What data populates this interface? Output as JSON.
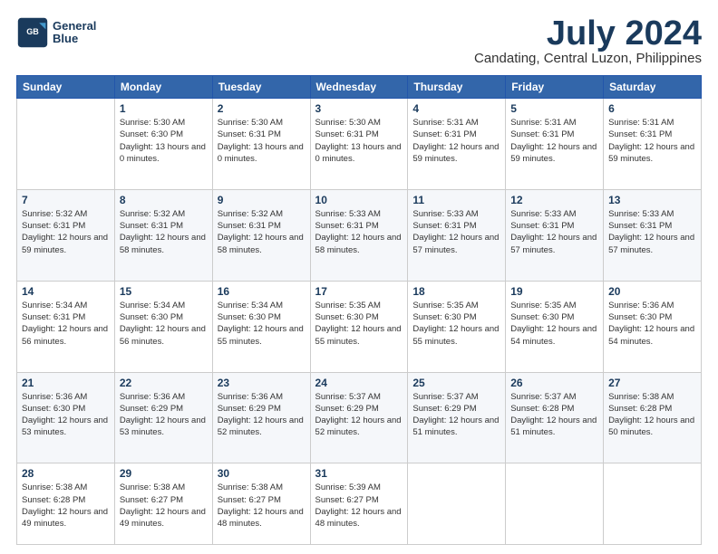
{
  "header": {
    "logo_line1": "General",
    "logo_line2": "Blue",
    "title": "July 2024",
    "location": "Candating, Central Luzon, Philippines"
  },
  "days_of_week": [
    "Sunday",
    "Monday",
    "Tuesday",
    "Wednesday",
    "Thursday",
    "Friday",
    "Saturday"
  ],
  "weeks": [
    [
      {
        "day": "",
        "sunrise": "",
        "sunset": "",
        "daylight": ""
      },
      {
        "day": "1",
        "sunrise": "Sunrise: 5:30 AM",
        "sunset": "Sunset: 6:30 PM",
        "daylight": "Daylight: 13 hours and 0 minutes."
      },
      {
        "day": "2",
        "sunrise": "Sunrise: 5:30 AM",
        "sunset": "Sunset: 6:31 PM",
        "daylight": "Daylight: 13 hours and 0 minutes."
      },
      {
        "day": "3",
        "sunrise": "Sunrise: 5:30 AM",
        "sunset": "Sunset: 6:31 PM",
        "daylight": "Daylight: 13 hours and 0 minutes."
      },
      {
        "day": "4",
        "sunrise": "Sunrise: 5:31 AM",
        "sunset": "Sunset: 6:31 PM",
        "daylight": "Daylight: 12 hours and 59 minutes."
      },
      {
        "day": "5",
        "sunrise": "Sunrise: 5:31 AM",
        "sunset": "Sunset: 6:31 PM",
        "daylight": "Daylight: 12 hours and 59 minutes."
      },
      {
        "day": "6",
        "sunrise": "Sunrise: 5:31 AM",
        "sunset": "Sunset: 6:31 PM",
        "daylight": "Daylight: 12 hours and 59 minutes."
      }
    ],
    [
      {
        "day": "7",
        "sunrise": "Sunrise: 5:32 AM",
        "sunset": "Sunset: 6:31 PM",
        "daylight": "Daylight: 12 hours and 59 minutes."
      },
      {
        "day": "8",
        "sunrise": "Sunrise: 5:32 AM",
        "sunset": "Sunset: 6:31 PM",
        "daylight": "Daylight: 12 hours and 58 minutes."
      },
      {
        "day": "9",
        "sunrise": "Sunrise: 5:32 AM",
        "sunset": "Sunset: 6:31 PM",
        "daylight": "Daylight: 12 hours and 58 minutes."
      },
      {
        "day": "10",
        "sunrise": "Sunrise: 5:33 AM",
        "sunset": "Sunset: 6:31 PM",
        "daylight": "Daylight: 12 hours and 58 minutes."
      },
      {
        "day": "11",
        "sunrise": "Sunrise: 5:33 AM",
        "sunset": "Sunset: 6:31 PM",
        "daylight": "Daylight: 12 hours and 57 minutes."
      },
      {
        "day": "12",
        "sunrise": "Sunrise: 5:33 AM",
        "sunset": "Sunset: 6:31 PM",
        "daylight": "Daylight: 12 hours and 57 minutes."
      },
      {
        "day": "13",
        "sunrise": "Sunrise: 5:33 AM",
        "sunset": "Sunset: 6:31 PM",
        "daylight": "Daylight: 12 hours and 57 minutes."
      }
    ],
    [
      {
        "day": "14",
        "sunrise": "Sunrise: 5:34 AM",
        "sunset": "Sunset: 6:31 PM",
        "daylight": "Daylight: 12 hours and 56 minutes."
      },
      {
        "day": "15",
        "sunrise": "Sunrise: 5:34 AM",
        "sunset": "Sunset: 6:30 PM",
        "daylight": "Daylight: 12 hours and 56 minutes."
      },
      {
        "day": "16",
        "sunrise": "Sunrise: 5:34 AM",
        "sunset": "Sunset: 6:30 PM",
        "daylight": "Daylight: 12 hours and 55 minutes."
      },
      {
        "day": "17",
        "sunrise": "Sunrise: 5:35 AM",
        "sunset": "Sunset: 6:30 PM",
        "daylight": "Daylight: 12 hours and 55 minutes."
      },
      {
        "day": "18",
        "sunrise": "Sunrise: 5:35 AM",
        "sunset": "Sunset: 6:30 PM",
        "daylight": "Daylight: 12 hours and 55 minutes."
      },
      {
        "day": "19",
        "sunrise": "Sunrise: 5:35 AM",
        "sunset": "Sunset: 6:30 PM",
        "daylight": "Daylight: 12 hours and 54 minutes."
      },
      {
        "day": "20",
        "sunrise": "Sunrise: 5:36 AM",
        "sunset": "Sunset: 6:30 PM",
        "daylight": "Daylight: 12 hours and 54 minutes."
      }
    ],
    [
      {
        "day": "21",
        "sunrise": "Sunrise: 5:36 AM",
        "sunset": "Sunset: 6:30 PM",
        "daylight": "Daylight: 12 hours and 53 minutes."
      },
      {
        "day": "22",
        "sunrise": "Sunrise: 5:36 AM",
        "sunset": "Sunset: 6:29 PM",
        "daylight": "Daylight: 12 hours and 53 minutes."
      },
      {
        "day": "23",
        "sunrise": "Sunrise: 5:36 AM",
        "sunset": "Sunset: 6:29 PM",
        "daylight": "Daylight: 12 hours and 52 minutes."
      },
      {
        "day": "24",
        "sunrise": "Sunrise: 5:37 AM",
        "sunset": "Sunset: 6:29 PM",
        "daylight": "Daylight: 12 hours and 52 minutes."
      },
      {
        "day": "25",
        "sunrise": "Sunrise: 5:37 AM",
        "sunset": "Sunset: 6:29 PM",
        "daylight": "Daylight: 12 hours and 51 minutes."
      },
      {
        "day": "26",
        "sunrise": "Sunrise: 5:37 AM",
        "sunset": "Sunset: 6:28 PM",
        "daylight": "Daylight: 12 hours and 51 minutes."
      },
      {
        "day": "27",
        "sunrise": "Sunrise: 5:38 AM",
        "sunset": "Sunset: 6:28 PM",
        "daylight": "Daylight: 12 hours and 50 minutes."
      }
    ],
    [
      {
        "day": "28",
        "sunrise": "Sunrise: 5:38 AM",
        "sunset": "Sunset: 6:28 PM",
        "daylight": "Daylight: 12 hours and 49 minutes."
      },
      {
        "day": "29",
        "sunrise": "Sunrise: 5:38 AM",
        "sunset": "Sunset: 6:27 PM",
        "daylight": "Daylight: 12 hours and 49 minutes."
      },
      {
        "day": "30",
        "sunrise": "Sunrise: 5:38 AM",
        "sunset": "Sunset: 6:27 PM",
        "daylight": "Daylight: 12 hours and 48 minutes."
      },
      {
        "day": "31",
        "sunrise": "Sunrise: 5:39 AM",
        "sunset": "Sunset: 6:27 PM",
        "daylight": "Daylight: 12 hours and 48 minutes."
      },
      {
        "day": "",
        "sunrise": "",
        "sunset": "",
        "daylight": ""
      },
      {
        "day": "",
        "sunrise": "",
        "sunset": "",
        "daylight": ""
      },
      {
        "day": "",
        "sunrise": "",
        "sunset": "",
        "daylight": ""
      }
    ]
  ]
}
